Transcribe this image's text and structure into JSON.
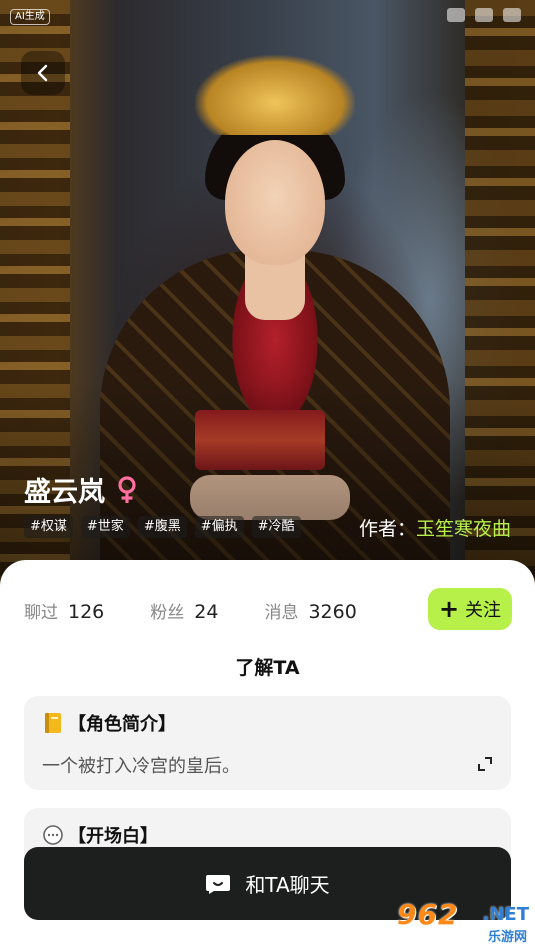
{
  "status_bar": {
    "ai_badge": "AI生成"
  },
  "character": {
    "name": "盛云岚",
    "tags": [
      "#权谋",
      "#世家",
      "#腹黑",
      "#偏执",
      "#冷酷"
    ],
    "author_label": "作者：",
    "author_name": "玉笙寒夜曲"
  },
  "stats": [
    {
      "label": "聊过",
      "value": "126"
    },
    {
      "label": "粉丝",
      "value": "24"
    },
    {
      "label": "消息",
      "value": "3260"
    }
  ],
  "follow_button": {
    "plus": "+",
    "label": "关注"
  },
  "section_title": "了解TA",
  "intro_card": {
    "title": "【角色简介】",
    "body": "一个被打入冷宫的皇后。"
  },
  "opening_card": {
    "title": "【开场白】"
  },
  "chat_button": {
    "label": "和TA聊天"
  },
  "watermark": {
    "main": "962",
    "net": ".NET",
    "sub": "乐游网"
  },
  "colors": {
    "accent_green": "#b8f04a",
    "gender_pink": "#ff6fa0",
    "button_dark": "#1d1f1f"
  },
  "icons": [
    "back-arrow-icon",
    "female-gender-icon",
    "book-icon",
    "expand-icon",
    "chat-bubble-icon",
    "chat-face-icon"
  ]
}
